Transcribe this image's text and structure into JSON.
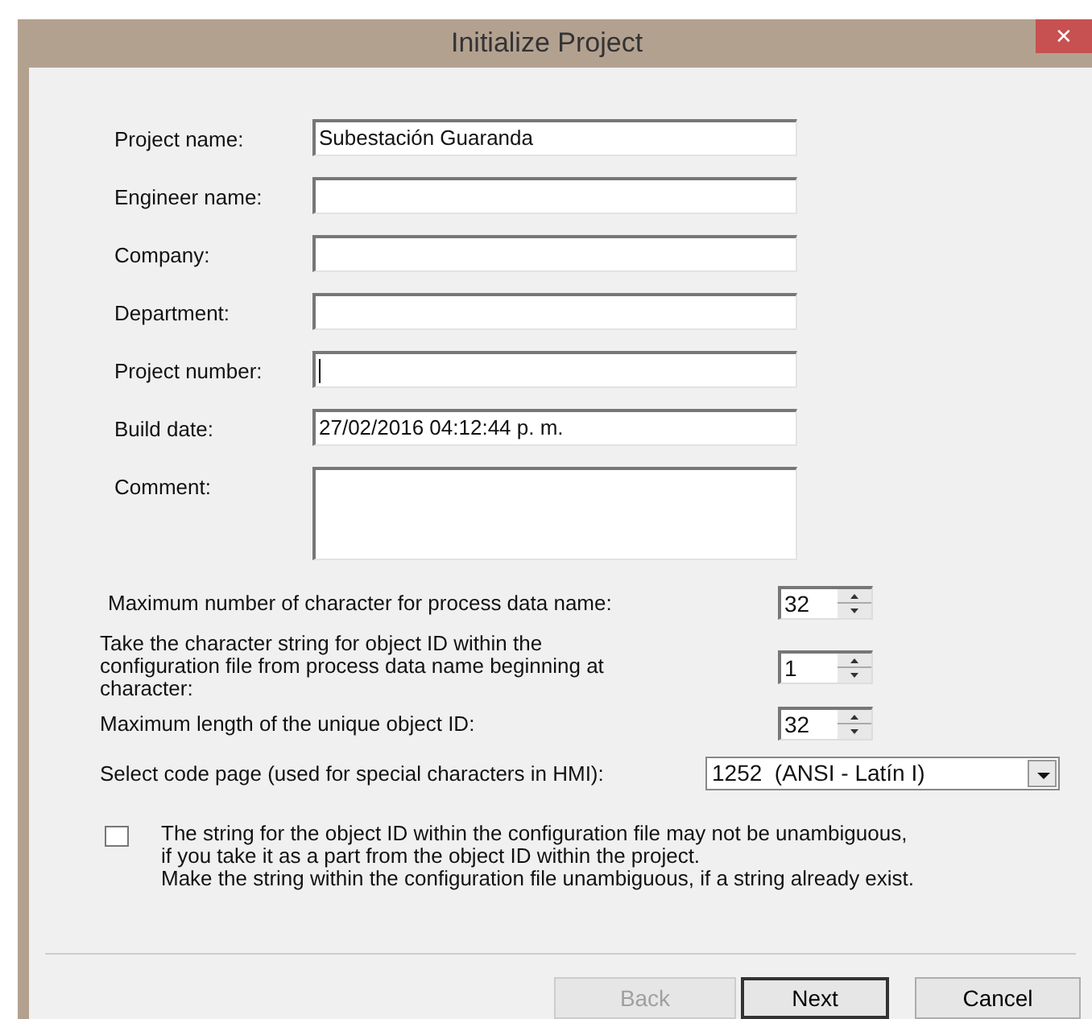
{
  "window": {
    "title": "Initialize Project",
    "close": "✕"
  },
  "fields": [
    {
      "label": "Project name:",
      "value": "Subestación Guaranda",
      "focused": false,
      "kind": "line"
    },
    {
      "label": "Engineer name:",
      "focused": false,
      "kind": "line"
    },
    {
      "label": "Company:",
      "focused": false,
      "kind": "line"
    },
    {
      "label": "Department:",
      "focused": false,
      "kind": "line"
    },
    {
      "label": "Project number:",
      "focused": true,
      "kind": "line"
    },
    {
      "label": "Build date:",
      "value": "27/02/2016 04:12:44 p. m.",
      "focused": false,
      "kind": "line"
    },
    {
      "label": "Comment:",
      "focused": false,
      "kind": "multiline"
    }
  ],
  "spinners": [
    {
      "label": "Maximum number of character for process data name:",
      "value": "32"
    },
    {
      "label": "Take the character string for object ID within the configuration file from process data name beginning at character:",
      "value": "1"
    },
    {
      "label": "Maximum length of the unique object ID:",
      "value": "32"
    }
  ],
  "code_page": {
    "label": "Select code page (used for special characters in HMI):",
    "value": "1252  (ANSI - Latín I)"
  },
  "option": {
    "checked": false,
    "lines": [
      "The string for the object ID within the configuration file may not be unambiguous,",
      "if you take it as a part from the object ID within the project.",
      "Make the string within the configuration file unambiguous, if a string already exist."
    ]
  },
  "buttons": [
    {
      "label": "Back",
      "disabled": true,
      "default": false
    },
    {
      "label": "Next",
      "disabled": false,
      "default": true
    },
    {
      "label": "Cancel",
      "disabled": false,
      "default": false
    }
  ]
}
